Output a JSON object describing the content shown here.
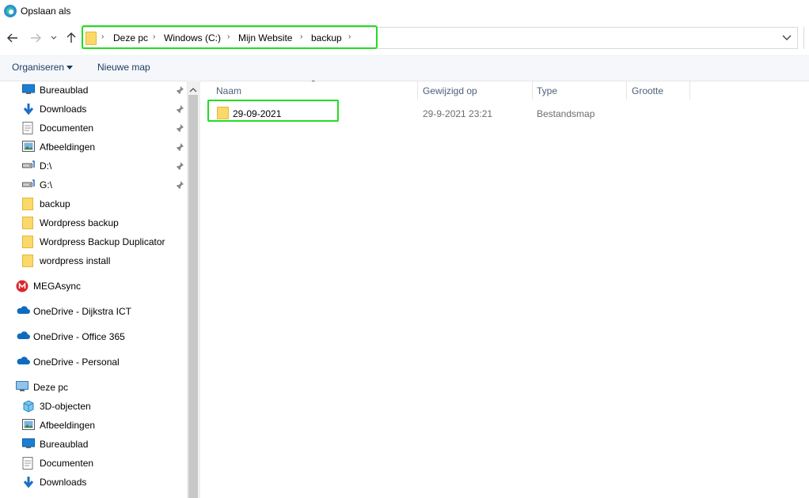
{
  "window": {
    "title": "Opslaan als"
  },
  "address": {
    "crumbs": [
      "Deze pc",
      "Windows (C:)",
      "Mijn Website",
      "backup"
    ]
  },
  "toolbar": {
    "organize_label": "Organiseren",
    "new_folder_label": "Nieuwe map"
  },
  "nav": {
    "quick_access": [
      {
        "label": "Bureaublad",
        "icon": "desktop-icon",
        "pinned": true
      },
      {
        "label": "Downloads",
        "icon": "download-arrow-icon",
        "pinned": true
      },
      {
        "label": "Documenten",
        "icon": "document-icon",
        "pinned": true
      },
      {
        "label": "Afbeeldingen",
        "icon": "pictures-icon",
        "pinned": true
      },
      {
        "label": "D:\\",
        "icon": "drive-icon",
        "pinned": true
      },
      {
        "label": "G:\\",
        "icon": "drive-icon",
        "pinned": true
      },
      {
        "label": "backup",
        "icon": "folder-icon",
        "pinned": false
      },
      {
        "label": "Wordpress backup",
        "icon": "folder-icon",
        "pinned": false
      },
      {
        "label": "Wordpress Backup Duplicator",
        "icon": "folder-icon",
        "pinned": false
      },
      {
        "label": "wordpress install",
        "icon": "folder-icon",
        "pinned": false
      }
    ],
    "roots": [
      {
        "label": "MEGAsync",
        "icon": "mega-icon"
      },
      {
        "label": "OneDrive - Dijkstra ICT",
        "icon": "onedrive-cloud-icon"
      },
      {
        "label": "OneDrive - Office 365",
        "icon": "onedrive-cloud-icon"
      },
      {
        "label": "OneDrive - Personal",
        "icon": "onedrive-cloud-icon"
      },
      {
        "label": "Deze pc",
        "icon": "computer-icon"
      }
    ],
    "this_pc": [
      {
        "label": "3D-objecten",
        "icon": "cube-3d-icon"
      },
      {
        "label": "Afbeeldingen",
        "icon": "pictures-icon"
      },
      {
        "label": "Bureaublad",
        "icon": "desktop-icon"
      },
      {
        "label": "Documenten",
        "icon": "document-icon"
      },
      {
        "label": "Downloads",
        "icon": "download-arrow-icon"
      }
    ]
  },
  "files": {
    "columns": [
      "Naam",
      "Gewijzigd op",
      "Type",
      "Grootte"
    ],
    "rows": [
      {
        "name": "29-09-2021",
        "modified": "29-9-2021 23:21",
        "type": "Bestandsmap",
        "size": ""
      }
    ]
  },
  "colors": {
    "highlight": "#22dd22",
    "folder": "#fbd968",
    "accent": "#0078d7"
  }
}
